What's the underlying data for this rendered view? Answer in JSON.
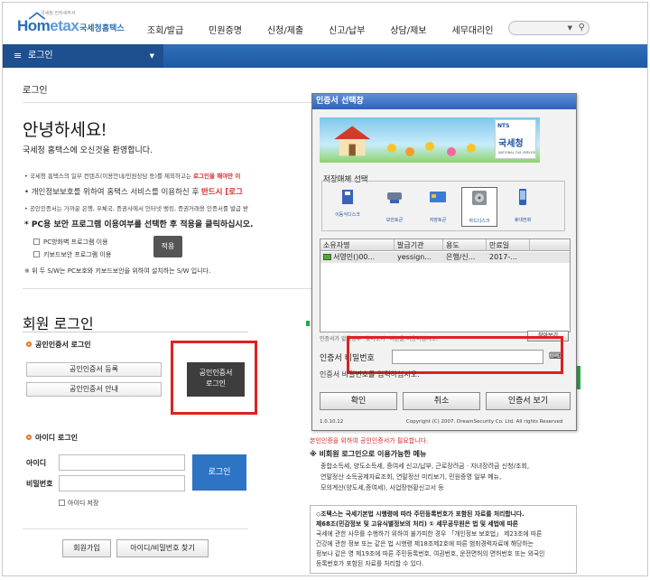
{
  "header": {
    "logo_tiny": "국세청 전자세무서",
    "logo_word_a": "Hom",
    "logo_word_b": "etax",
    "logo_sub": "국세청홈택스",
    "nav": [
      "조회/발급",
      "민원증명",
      "신청/제출",
      "신고/납부",
      "상담/제보",
      "세무대리인"
    ],
    "menu_label": "로그인"
  },
  "page": {
    "breadcrumb": "로그인",
    "hello": "안녕하세요!",
    "welcome": "국세청 홈택스에 오신것을 환영합니다.",
    "note1_a": "국세청 홈택스의 일부 컨텐츠(이용안내/민원상담 등)를 제외하고는 ",
    "note1_b": "로그인을 해야만 이",
    "note2_a": "개인정보보호를 위하여 홈택스 서비스를 이용하신 후 ",
    "note2_b": "반드시 [로그",
    "note3": "공인인증서는 가까운 은행, 우체국, 증권사에서 인터넷 뱅킹, 증권거래용 인증서를 발급 받",
    "pc_note": "* PC용 보안 프로그램 이용여부를 선택한 후 적용을 클릭하십시오.",
    "opt_firewall": "PC방화벽 프로그램 이용",
    "opt_keyboard": "키보드보안 프로그램 이용",
    "apply": "적용",
    "sw_note": "※ 위 두 S/W는 PC보호와 키보드보안을 위하여 설치하는 S/W 입니다.",
    "member_login": "회원 로그인",
    "cert_section": "공인인증서 로그인",
    "cert_register": "공인인증서 등록",
    "cert_guide": "공인인증서 안내",
    "cert_login_1": "공인인증서",
    "cert_login_2": "로그인",
    "id_section": "아이디 로그인",
    "id_label": "아이디",
    "pw_label": "비밀번호",
    "login": "로그인",
    "save_id": "아이디 저장",
    "join": "회원가입",
    "find": "아이디/비밀번호 찾기"
  },
  "right": {
    "red_note": "본인인증을 위하여 공인인증서가 필요합니다.",
    "nonmember_title": "※ 비회원 로그인으로 이용가능한 메뉴",
    "nonmember_1": "종합소득세, 양도소득세, 증여세 신고/납부, 근로장려금 · 자녀장려금 신청/조회,",
    "nonmember_2": "연말정산 소득공제자료조회, 연말정산 미리보기, 민원증명 일부 메뉴,",
    "nonmember_3": "모의계산(양도세,증여세), 사업장현황신고서 등",
    "box_1_a": "◇조택스는 국세기본법 시행령에 따라 주민등록번호가 포함된 자료를 처리합니다.",
    "box_2_a": "제68조(민감정보 및 고유식별정보의 처리) ① 세무공무원은 법 및 세법에 따른",
    "box_3": "국세에 관한 사무를 수행하기 위하여 불가피한 경우 「개인정보 보호법」 제23조에 따른",
    "box_4": "건강에 관한 정보 또는 같은 법 시행령 제18조제2호에 따른 범죄경력자료에 해당하는",
    "box_5": "정보나 같은 영 제19조에 따른 주민등록번호, 여권번호, 운전면허의 면허번호 또는 외국인",
    "box_6": "등록번호가 포함된 자료를 처리할 수 있다."
  },
  "dialog": {
    "title": "인증서 선택창",
    "nts_top": "NTS",
    "nts_name": "국세청",
    "nts_en": "NATIONAL TAX SERVICE",
    "storage_label": "저장매체 선택",
    "storage": [
      {
        "name": "이동식디스크",
        "icon": "usb-drive-icon"
      },
      {
        "name": "보안토큰",
        "icon": "security-token-icon"
      },
      {
        "name": "저장토큰",
        "icon": "smart-card-icon"
      },
      {
        "name": "하드디스크",
        "icon": "hard-disk-icon"
      },
      {
        "name": "휴대전화",
        "icon": "mobile-phone-icon"
      }
    ],
    "columns": [
      "소유자명",
      "발급기관",
      "용도",
      "만료일"
    ],
    "rows": [
      [
        "서영민()00...",
        "yessign...",
        "은행/신...",
        "2017-..."
      ]
    ],
    "hint": "인증서가 없을경우 \"찾아보기\" 버튼을 이용하십시오.",
    "find_btn": "찾아보기",
    "pw_label": "인증서 비밀번호",
    "pw_hint": "인증서 비밀번호를 입력하십시오.",
    "ok": "확인",
    "cancel": "취소",
    "view": "인증서 보기",
    "version": "1.0.10.12",
    "copyright": "Copyright (C) 2007. DreamSecurity Co. Ltd. All rights Reserved"
  },
  "colors": {
    "brand_blue": "#2a6db5",
    "menu_bar": "#1f5aa3",
    "highlight_red": "#e02020",
    "accent_orange": "#e8731a"
  }
}
